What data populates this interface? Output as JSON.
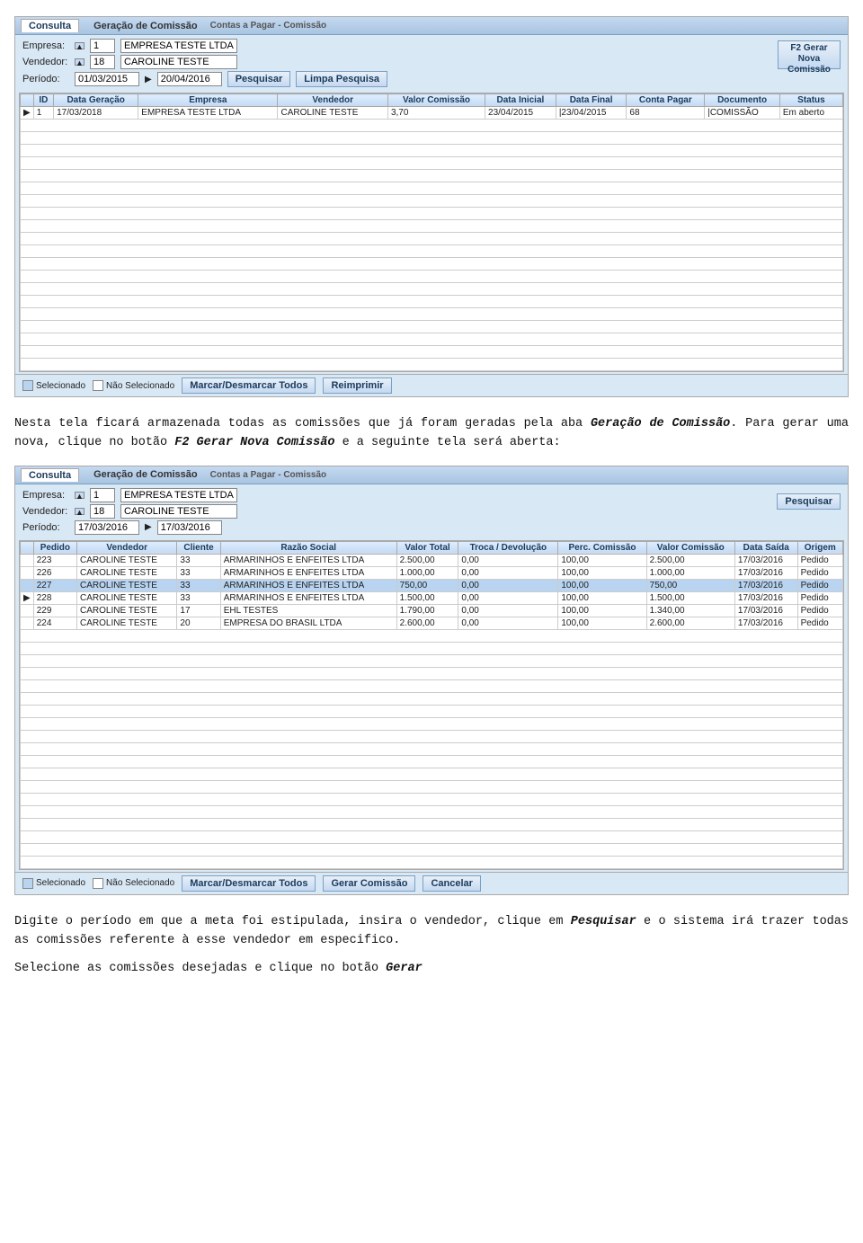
{
  "panel1": {
    "title": "Contas a Pagar - Comissão",
    "tab_active": "Consulta",
    "tab_inactive": "Geração de Comissão",
    "fields": {
      "empresa_label": "Empresa:",
      "empresa_val": "1",
      "empresa_name": "EMPRESA TESTE LTDA",
      "vendedor_label": "Vendedor:",
      "vendedor_val": "18",
      "vendedor_name": "CAROLINE TESTE",
      "periodo_label": "Período:",
      "periodo_from": "01/03/2015",
      "periodo_to": "20/04/2016"
    },
    "buttons": {
      "pesquisar": "Pesquisar",
      "limpa": "Limpa Pesquisa",
      "f2": "F2 Gerar Nova\nComissão"
    },
    "table": {
      "headers": [
        "ID",
        "Data Geração",
        "Empresa",
        "Vendedor",
        "Valor Comissão",
        "Data Inicial",
        "Data Final",
        "Conta Pagar",
        "Documento",
        "Status"
      ],
      "rows": [
        {
          "arrow": "▶",
          "id": "1",
          "data_geracao": "17/03/2018",
          "empresa": "EMPRESA TESTE LTDA",
          "vendedor": "CAROLINE TESTE",
          "valor": "3,70",
          "data_ini": "23/04/2015",
          "data_fin": "23/04/2015",
          "conta": "68",
          "doc": "COMISSÃO",
          "status": "Em aberto"
        }
      ]
    },
    "bottom": {
      "selecionado": "Selecionado",
      "nao_selecionado": "Não Selecionado",
      "marcar": "Marcar/Desmarcar Todos",
      "reimprimir": "Reimprimir"
    }
  },
  "text1": {
    "p1": "Nesta tela ficará armazenada todas as comissões que já foram geradas pela aba ",
    "p1_bold": "Geração de Comissão",
    "p1_end": ". Para gerar uma nova, clique no botão ",
    "p1_bold2": "F2 Gerar Nova Comissão",
    "p1_end2": " e a seguinte tela será aberta:"
  },
  "panel2": {
    "title": "Contas a Pagar - Comissão",
    "tab_active": "Consulta",
    "tab_inactive": "Geração de Comissão",
    "fields": {
      "empresa_label": "Empresa:",
      "empresa_val": "1",
      "empresa_name": "EMPRESA TESTE LTDA",
      "vendedor_label": "Vendedor:",
      "vendedor_val": "18",
      "vendedor_name": "CAROLINE TESTE",
      "periodo_label": "Período:",
      "periodo_from": "17/03/2016",
      "periodo_to": "17/03/2016"
    },
    "buttons": {
      "pesquisar": "Pesquisar"
    },
    "table": {
      "headers": [
        "Pedido",
        "Vendedor",
        "Cliente",
        "Razão Social",
        "Valor Total",
        "Troca / Devolução",
        "Perc. Comissão",
        "Valor Comissão",
        "Data Saída",
        "Origem"
      ],
      "rows": [
        {
          "arrow": "",
          "pedido": "223",
          "vendedor": "CAROLINE TESTE",
          "cliente": "33",
          "razao": "ARMARINHOS E ENFEITES LTDA",
          "valor_total": "2.500,00",
          "troca": "0,00",
          "perc": "100,00",
          "valor_com": "2.500,00",
          "data_saida": "17/03/2016",
          "origem": "Pedido",
          "selected": false
        },
        {
          "arrow": "",
          "pedido": "226",
          "vendedor": "CAROLINE TESTE",
          "cliente": "33",
          "razao": "ARMARINHOS E ENFEITES LTDA",
          "valor_total": "1.000,00",
          "troca": "0,00",
          "perc": "100,00",
          "valor_com": "1.000,00",
          "data_saida": "17/03/2016",
          "origem": "Pedido",
          "selected": false
        },
        {
          "arrow": "",
          "pedido": "227",
          "vendedor": "CAROLINE TESTE",
          "cliente": "33",
          "razao": "ARMARINHOS E ENFEITES LTDA",
          "valor_total": "750,00",
          "troca": "0,00",
          "perc": "100,00",
          "valor_com": "750,00",
          "data_saida": "17/03/2016",
          "origem": "Pedido",
          "selected": true
        },
        {
          "arrow": "▶",
          "pedido": "228",
          "vendedor": "CAROLINE TESTE",
          "cliente": "33",
          "razao": "ARMARINHOS E ENFEITES LTDA",
          "valor_total": "1.500,00",
          "troca": "0,00",
          "perc": "100,00",
          "valor_com": "1.500,00",
          "data_saida": "17/03/2016",
          "origem": "Pedido",
          "selected": false
        },
        {
          "arrow": "",
          "pedido": "229",
          "vendedor": "CAROLINE TESTE",
          "cliente": "17",
          "razao": "EHL TESTES",
          "valor_total": "1.790,00",
          "troca": "0,00",
          "perc": "100,00",
          "valor_com": "1.340,00",
          "data_saida": "17/03/2016",
          "origem": "Pedido",
          "selected": false
        },
        {
          "arrow": "",
          "pedido": "224",
          "vendedor": "CAROLINE TESTE",
          "cliente": "20",
          "razao": "EMPRESA DO BRASIL LTDA",
          "valor_total": "2.600,00",
          "troca": "0,00",
          "perc": "100,00",
          "valor_com": "2.600,00",
          "data_saida": "17/03/2016",
          "origem": "Pedido",
          "selected": false
        }
      ]
    },
    "bottom": {
      "selecionado": "Selecionado",
      "nao_selecionado": "Não Selecionado",
      "marcar": "Marcar/Desmarcar Todos",
      "gerar": "Gerar Comissão",
      "cancelar": "Cancelar"
    }
  },
  "text2": {
    "p1": "Digite o período em que a meta foi estipulada, insira o vendedor, clique em ",
    "p1_bold": "Pesquisar",
    "p1_end": " e o sistema irá trazer todas as comissões referente à esse vendedor em especifico.",
    "p2": "Selecione as comissões desejadas e clique no botão ",
    "p2_bold": "Gerar"
  }
}
